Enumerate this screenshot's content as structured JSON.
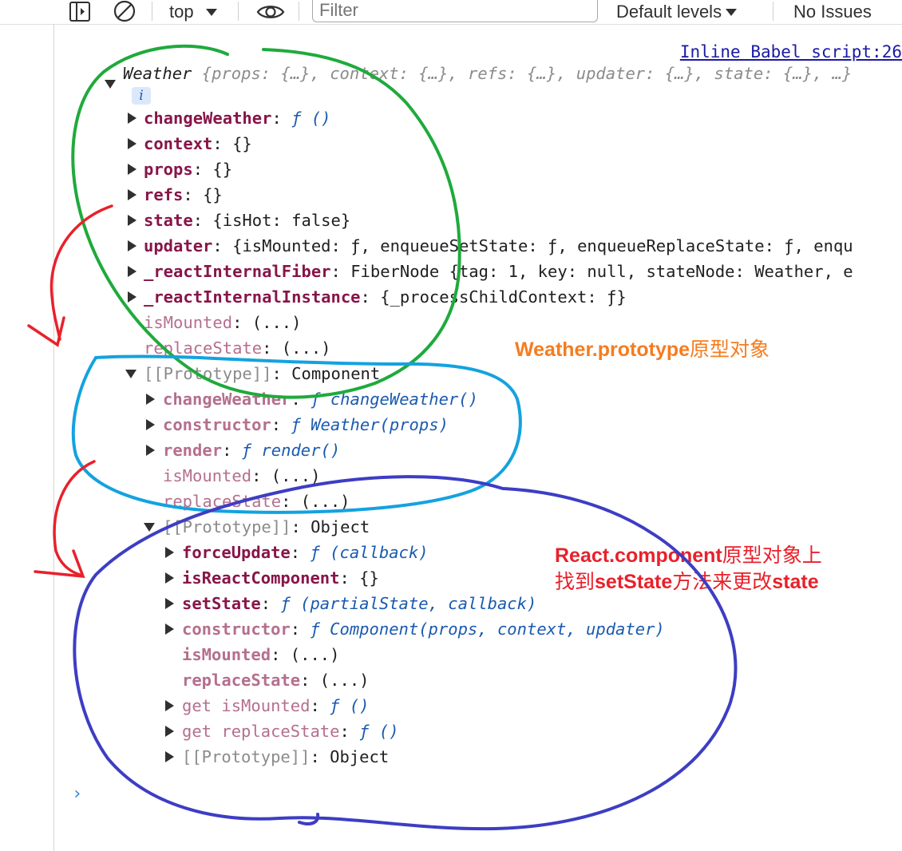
{
  "toolbar": {
    "context_label": "top",
    "filter_placeholder": "Filter",
    "levels_label": "Default levels",
    "issues_label": "No Issues"
  },
  "console": {
    "source_link": "Inline Babel script:26",
    "summary": {
      "class_name": "Weather",
      "preview": "{props: {…}, context: {…}, refs: {…}, updater: {…}, state: {…}, …}",
      "info_badge": "i"
    },
    "own_props": [
      {
        "key": "changeWeather",
        "value": "ƒ ()"
      },
      {
        "key": "context",
        "value": "{}"
      },
      {
        "key": "props",
        "value": "{}"
      },
      {
        "key": "refs",
        "value": "{}"
      },
      {
        "key": "state",
        "value": "{isHot: false}"
      },
      {
        "key": "updater",
        "value": "{isMounted: ƒ, enqueueSetState: ƒ, enqueueReplaceState: ƒ, enqu"
      },
      {
        "key": "_reactInternalFiber",
        "value": "FiberNode {tag: 1, key: null, stateNode: Weather, e"
      },
      {
        "key": "_reactInternalInstance",
        "value": "{_processChildContext: ƒ}"
      },
      {
        "key": "isMounted",
        "value": "(...)"
      },
      {
        "key": "replaceState",
        "value": "(...)"
      }
    ],
    "proto1": {
      "label": "[[Prototype]]",
      "value": "Component",
      "items": [
        {
          "key": "changeWeather",
          "value": "ƒ changeWeather()"
        },
        {
          "key": "constructor",
          "value": "ƒ Weather(props)"
        },
        {
          "key": "render",
          "value": "ƒ render()"
        },
        {
          "key": "isMounted",
          "value": "(...)"
        },
        {
          "key": "replaceState",
          "value": "(...)"
        }
      ]
    },
    "proto2": {
      "label": "[[Prototype]]",
      "value": "Object",
      "items": [
        {
          "key": "forceUpdate",
          "value": "ƒ (callback)"
        },
        {
          "key": "isReactComponent",
          "value": "{}"
        },
        {
          "key": "setState",
          "value": "ƒ (partialState, callback)"
        },
        {
          "key": "constructor",
          "value": "ƒ Component(props, context, updater)"
        },
        {
          "key": "isMounted",
          "value": "(...)"
        },
        {
          "key": "replaceState",
          "value": "(...)"
        },
        {
          "key": "get isMounted",
          "value": "ƒ ()"
        },
        {
          "key": "get replaceState",
          "value": "ƒ ()"
        }
      ],
      "last": {
        "label": "[[Prototype]]",
        "value": "Object"
      }
    },
    "prompt_symbol": "›"
  },
  "annotations": {
    "orange_a": "Weather.prototype",
    "orange_b": "原型对象",
    "red1_a": "React.component",
    "red1_b": "原型对象上",
    "red2_a": "找到",
    "red2_b": "setState",
    "red2_c": "方法来更改",
    "red2_d": "state"
  },
  "colors": {
    "green_circle": "#1faa3c",
    "cyan_circle": "#14a2df",
    "blue_circle": "#3d3dc4",
    "red_arrow": "#e8212b",
    "orange_note": "#f57c1f"
  }
}
